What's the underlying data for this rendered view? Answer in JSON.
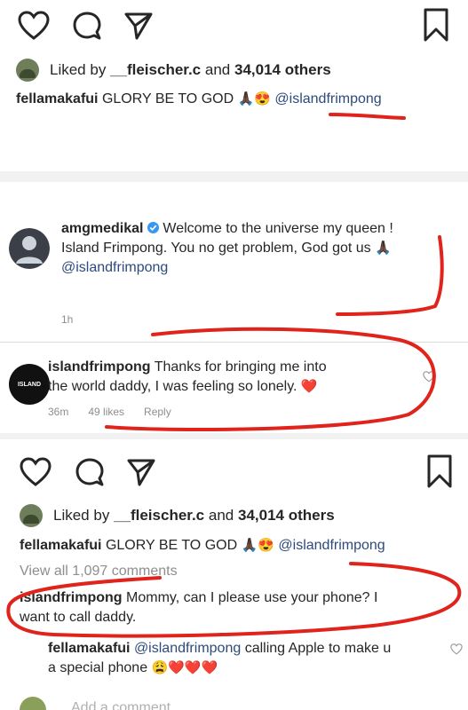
{
  "post_top": {
    "liked_by_prefix": "Liked by",
    "liked_by_user": "__fleischer.c",
    "liked_by_and": "and",
    "liked_by_count": "34,014 others",
    "caption_user": "fellamakafui",
    "caption_text": "GLORY BE TO GOD",
    "caption_emoji": "🙏🏿😍",
    "caption_mention": "@islandfrimpong"
  },
  "comments_panel": {
    "comment1": {
      "user": "amgmedikal",
      "verified_icon": "verified-badge",
      "text_line1": "Welcome to the universe my queen !",
      "text_line2": "Island Frimpong. You no get problem, God got us",
      "emoji": "🙏🏿",
      "mention": "@islandfrimpong",
      "time": "1h"
    },
    "comment2": {
      "user": "islandfrimpong",
      "avatar_text": "ISLAND",
      "text_line1": "Thanks for bringing me into",
      "text_line2": "the world daddy, I was feeling so lonely.",
      "emoji": "❤️",
      "time": "36m",
      "likes": "49 likes",
      "reply": "Reply"
    }
  },
  "post_bottom": {
    "liked_by_prefix": "Liked by",
    "liked_by_user": "__fleischer.c",
    "liked_by_and": "and",
    "liked_by_count": "34,014 others",
    "caption_user": "fellamakafui",
    "caption_text": "GLORY BE TO GOD",
    "caption_emoji": "🙏🏿😍",
    "caption_mention": "@islandfrimpong",
    "view_all": "View all 1,097 comments",
    "comment1_user": "islandfrimpong",
    "comment1_line1": "Mommy, can I please use your phone? I",
    "comment1_line2": "want to call daddy.",
    "comment2_user": "fellamakafui",
    "comment2_mention": "@islandfrimpong",
    "comment2_line1": "calling Apple to make u",
    "comment2_line2": "a special phone",
    "comment2_emoji": "😩❤️❤️❤️",
    "add_comment": "Add a comment..."
  },
  "colors": {
    "scribble": "#e0241b",
    "mention": "#2c4a7c",
    "heart": "#e0241b",
    "verified": "#3897f0"
  }
}
